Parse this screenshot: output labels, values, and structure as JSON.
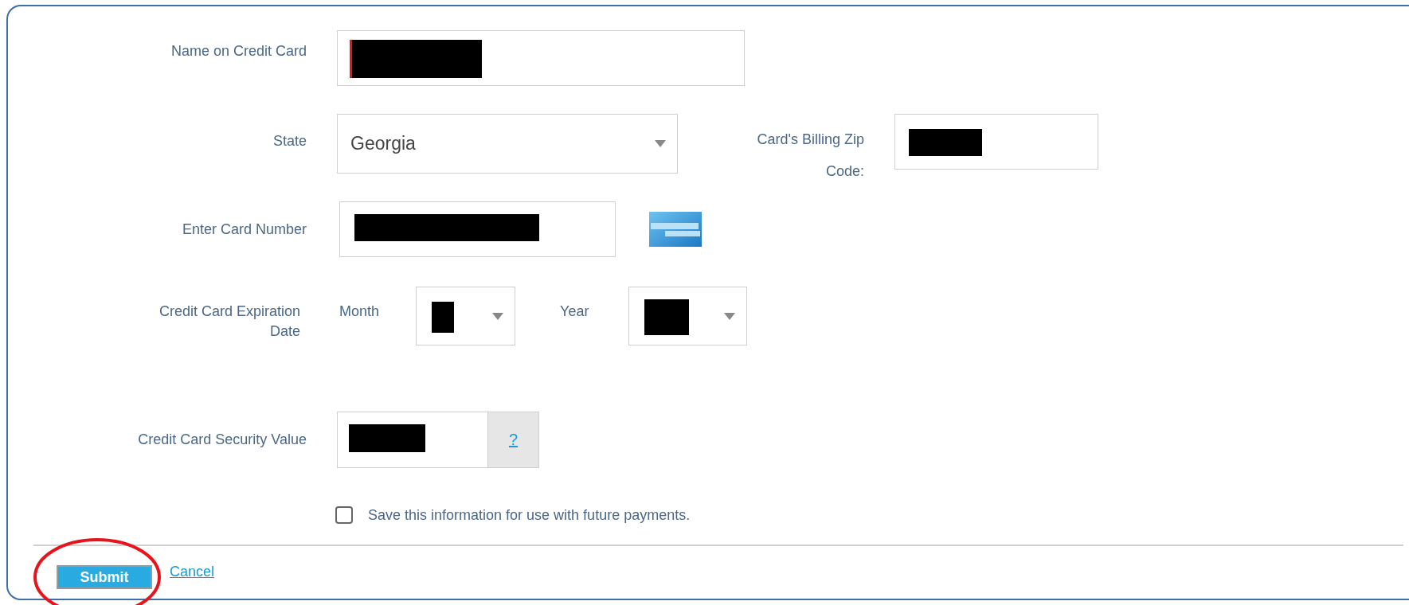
{
  "name_on_card": {
    "label": "Name on Credit Card",
    "redacted": true
  },
  "state": {
    "label": "State",
    "value": "Georgia"
  },
  "billing_zip": {
    "label_lines": [
      "Card's Billing Zip",
      "Code:"
    ],
    "redacted": true
  },
  "card_number": {
    "label": "Enter Card Number",
    "redacted": true
  },
  "expiration": {
    "label_lines": [
      "Credit Card Expiration",
      "Date"
    ],
    "month_label": "Month",
    "month_redacted": true,
    "year_label": "Year",
    "year_redacted": true
  },
  "security": {
    "label": "Credit Card Security Value",
    "redacted": true,
    "help": "?"
  },
  "save_info": {
    "label": "Save this information for use with future payments.",
    "checked": false
  },
  "buttons": {
    "submit": "Submit",
    "cancel": "Cancel",
    "submit_circled": true
  }
}
